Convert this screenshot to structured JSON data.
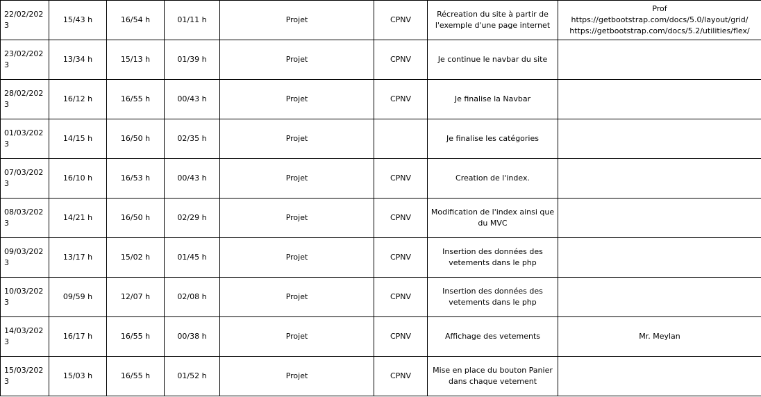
{
  "rows": [
    {
      "date": "22/02/2023",
      "start": "15/43 h",
      "end": "16/54 h",
      "duration": "01/11 h",
      "type": "Projet",
      "place": "CPNV",
      "description": [
        "Récreation du site à partir de",
        "l'exemple d'une page internet"
      ],
      "remarks": [
        "Prof",
        "https://getbootstrap.com/docs/5.0/layout/grid/",
        "https://getbootstrap.com/docs/5.2/utilities/flex/"
      ]
    },
    {
      "date": "23/02/2023",
      "start": "13/34 h",
      "end": "15/13 h",
      "duration": "01/39 h",
      "type": "Projet",
      "place": "CPNV",
      "description": [
        "Je continue le navbar du site"
      ],
      "remarks": []
    },
    {
      "date": "28/02/2023",
      "start": "16/12 h",
      "end": "16/55 h",
      "duration": "00/43 h",
      "type": "Projet",
      "place": "CPNV",
      "description": [
        "Je finalise la Navbar"
      ],
      "remarks": []
    },
    {
      "date": "01/03/2023",
      "start": "14/15 h",
      "end": "16/50 h",
      "duration": "02/35 h",
      "type": "Projet",
      "place": "",
      "description": [
        "Je finalise les catégories"
      ],
      "remarks": []
    },
    {
      "date": "07/03/2023",
      "start": "16/10 h",
      "end": "16/53 h",
      "duration": "00/43 h",
      "type": "Projet",
      "place": "CPNV",
      "description": [
        "Creation de l'index."
      ],
      "remarks": []
    },
    {
      "date": "08/03/2023",
      "start": "14/21 h",
      "end": "16/50 h",
      "duration": "02/29 h",
      "type": "Projet",
      "place": "CPNV",
      "description": [
        "Modification de l'index ainsi que",
        "du MVC"
      ],
      "remarks": []
    },
    {
      "date": "09/03/2023",
      "start": "13/17 h",
      "end": "15/02 h",
      "duration": "01/45 h",
      "type": "Projet",
      "place": "CPNV",
      "description": [
        "Insertion des données des",
        "vetements dans le php"
      ],
      "remarks": []
    },
    {
      "date": "10/03/2023",
      "start": "09/59 h",
      "end": "12/07 h",
      "duration": "02/08 h",
      "type": "Projet",
      "place": "CPNV",
      "description": [
        "Insertion des données des",
        "vetements dans le php"
      ],
      "remarks": []
    },
    {
      "date": "14/03/2023",
      "start": "16/17 h",
      "end": "16/55 h",
      "duration": "00/38 h",
      "type": "Projet",
      "place": "CPNV",
      "description": [
        "Affichage des vetements"
      ],
      "remarks": [
        "Mr. Meylan"
      ]
    },
    {
      "date": "15/03/2023",
      "start": "15/03 h",
      "end": "16/55 h",
      "duration": "01/52 h",
      "type": "Projet",
      "place": "CPNV",
      "description": [
        "Mise en place du bouton Panier",
        "dans chaque vetement"
      ],
      "remarks": []
    }
  ]
}
